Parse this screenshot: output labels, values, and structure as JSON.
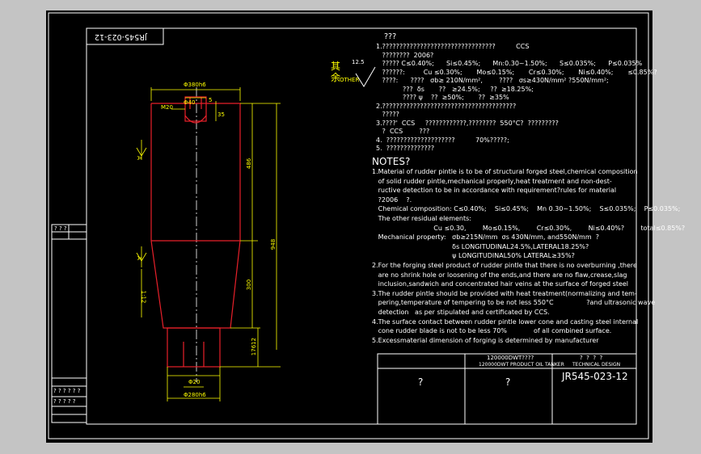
{
  "drawing_number": "JR545-023-12",
  "chinese": {
    "title": "???",
    "items": [
      "1.?????????????????????????????????          CCS",
      "   ????????  2006?",
      "   ????? C≤0.40%;      Si≤0.45%;      Mn:0.30~1.50%;      S≤0.035%;      P≤0.035%",
      "   ??????:         Cu ≤0.30%;       Mo≤0.15%;       Cr≤0.30%;       Ni≤0.40%;       ≤0.85%?",
      "   ????:      ????   σb≥ 210N/mm²,        ????   σs≥430N/mm² ?550N/mm²;",
      "             ???  δs       ??   ≥24.5%;     ??  ≥18.25%;",
      "             ???? ψ    ??  ≥50%;       ??  ≥35%",
      "2.???????????????????????????????????????",
      "   ?????",
      "3.????'  CCS     ????????????,????????  550°C?  ?????????",
      "   ?  CCS        ???",
      "4.  ????????????????????          70%?????;",
      "5.  ??????????????"
    ],
    "other_label": "OTHER",
    "roughness": "12.5"
  },
  "notes": {
    "title": "NOTES?",
    "lines": [
      "1.Material of rudder pintle is to be of structural forged steel,chemical composition",
      "   of solid rudder pintle,mechanical properly,heat treatment and non-dest-",
      "   ructive detection to be in accordance with requirement?rules for material",
      "   ?2006    ?.",
      "   Chemical composition: C≤0.40%;    Si≤0.45%;    Mn 0.30~1.50%;    S≤0.035%;    P≤0.035%;",
      "   The other residual elements:",
      "                              Cu ≤0.30,        Mo≤0.15%,        Cr≤0.30%,        Ni≤0.40%?        total≤0.85%?",
      "   Mechanical property:   σb≥215N/mm  σs 430N/mm, and550N/mm  ?",
      "                                       δs LONGITUDINAL24.5%,LATERAL18.25%?",
      "                                       ψ LONGITUDINAL50% LATERAL≥35%?",
      "2.For the forging steel product of rudder pintle that there is no overburning ,there",
      "   are no shrink hole or loosening of the ends,and there are no flaw,crease,slag",
      "   inclusion,sandwich and concentrated hair veins at the surface of forged steel",
      "3.The rudder pintle should be provided with heat treatment(normalizing and tem-",
      "   pering,temperature of tempering to be not less 550°C                ?and ultrasonic wave",
      "   detection   as per stipulated and certificated by CCS.",
      "4.The surface contact between rudder pintle lower cone and casting steel internal",
      "   cone rudder blade is not to be less 70%             of all combined surface.",
      "5.Excessmaterial dimension of forging is determined by manufacturer"
    ]
  },
  "title_block": {
    "company_cn": "120000DWT????",
    "company_en": "120000DWT PRODUCT OIL TANKER",
    "dept_cn": "?  ?  ?  ?",
    "dept_en": "TECHNICAL DESIGN",
    "name_cell": "?",
    "code_cell": "?",
    "drawing_no": "JR545-023-12"
  },
  "left_tags": [
    "? ? ?",
    "? ? ? ? ? ?",
    "? ? ? ? ?"
  ],
  "dimensions": {
    "d_top": "Φ380h6",
    "d_bottom": "Φ280h6",
    "d_ring": "Φ380",
    "d_bore": "Φ40",
    "m_thread": "M20",
    "d_hole": "Φ20",
    "small_35": "35",
    "small_t": "5",
    "len_upper": "486",
    "len_total": "948",
    "len_cone": "300",
    "len_shaft": "176",
    "len_12": "12",
    "taper": "1:12",
    "angle": "24°",
    "sec_top": "A",
    "sec_mid": "A"
  },
  "colors": {
    "red": "#e8202a",
    "yellow": "#ffff00",
    "white": "#ffffff"
  }
}
